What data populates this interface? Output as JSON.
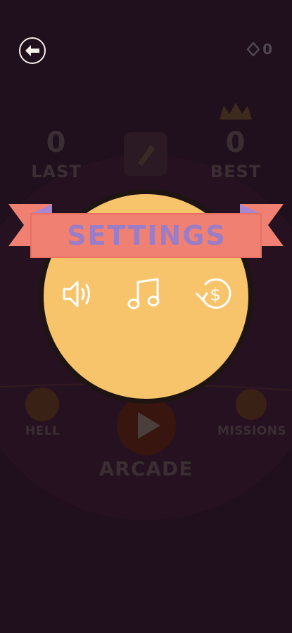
{
  "header": {
    "gem_count": "0"
  },
  "scores": {
    "last": {
      "value": "0",
      "label": "LAST"
    },
    "best": {
      "value": "0",
      "label": "BEST"
    }
  },
  "modes": {
    "left_label": "HELL",
    "right_label": "MISSIONS",
    "main_label": "ARCADE"
  },
  "settings": {
    "title": "SETTINGS",
    "options": [
      "sound-icon",
      "music-icon",
      "restore-purchases-icon"
    ]
  },
  "colors": {
    "background": "#200f1c",
    "panel": "#f7c46c",
    "ribbon": "#f08072",
    "ribbon_fold": "#a886d0",
    "title_text": "#9b7cc6",
    "icon": "#ffffff"
  }
}
